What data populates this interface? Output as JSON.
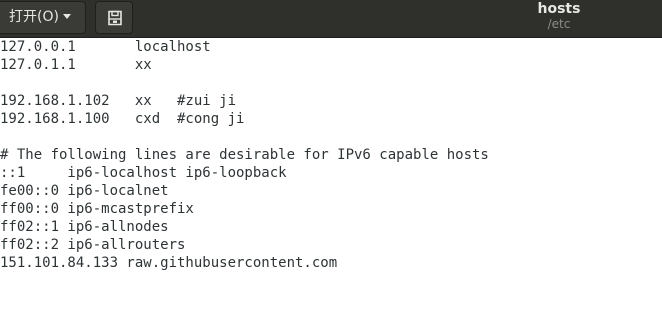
{
  "toolbar": {
    "open_label": "打开(O)",
    "open_dropdown_icon": "chevron-down-icon",
    "save_icon": "save-to-disk-icon"
  },
  "window": {
    "title": "hosts",
    "subtitle": "/etc"
  },
  "editor": {
    "lines": [
      "127.0.0.1       localhost",
      "127.0.1.1       xx",
      "",
      "192.168.1.102   xx   #zui ji",
      "192.168.1.100   cxd  #cong ji",
      "",
      "# The following lines are desirable for IPv6 capable hosts",
      "::1     ip6-localhost ip6-loopback",
      "fe00::0 ip6-localnet",
      "ff00::0 ip6-mcastprefix",
      "ff02::1 ip6-allnodes",
      "ff02::2 ip6-allrouters",
      "151.101.84.133 raw.githubusercontent.com"
    ]
  }
}
